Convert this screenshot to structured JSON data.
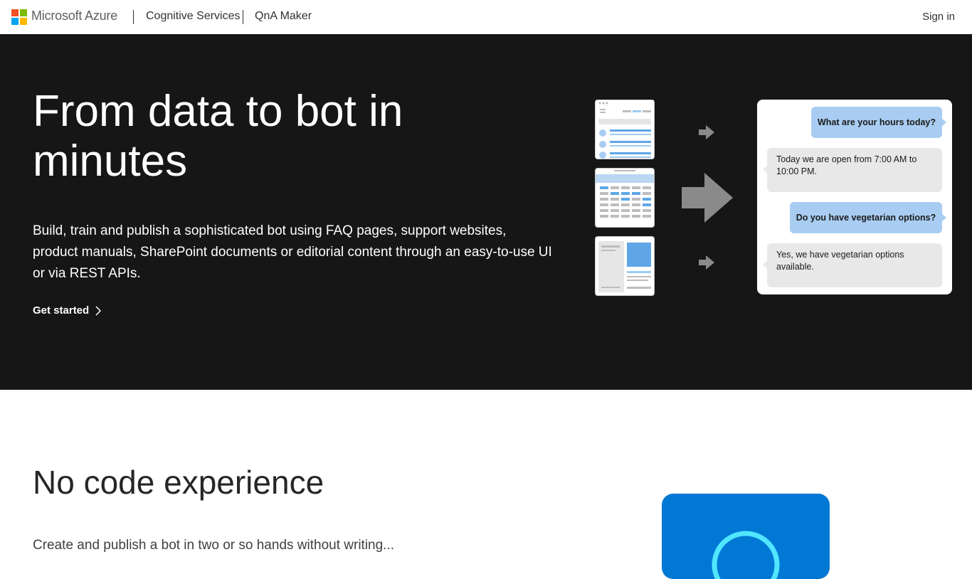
{
  "header": {
    "brand": "Microsoft Azure",
    "nav": [
      "Cognitive Services",
      "QnA Maker"
    ],
    "signin": "Sign in",
    "logo_colors": [
      "#f25022",
      "#7fba00",
      "#00a4ef",
      "#ffb900"
    ]
  },
  "hero": {
    "title": "From data to bot in minutes",
    "description": "Build, train and publish a sophisticated bot using FAQ pages, support websites, product manuals, SharePoint documents or editorial content through an easy-to-use UI or via REST APIs.",
    "cta": "Get started",
    "background": "#171616"
  },
  "chat": {
    "messages": [
      {
        "from": "user",
        "text": "What are your hours today?"
      },
      {
        "from": "bot",
        "text": "Today we are open from 7:00 AM to 10:00 PM."
      },
      {
        "from": "user",
        "text": "Do you have vegetarian options?"
      },
      {
        "from": "bot",
        "text": "Yes, we have vegetarian options available."
      }
    ]
  },
  "section2": {
    "title": "No code experience",
    "text": "Create and publish a bot in two or so hands without writing...",
    "accent": "#0078d4"
  }
}
